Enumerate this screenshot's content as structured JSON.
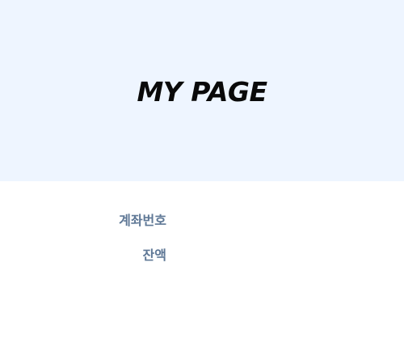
{
  "header": {
    "title": "MY PAGE"
  },
  "account_info": {
    "account_number_label": "계좌번호",
    "balance_label": "잔액"
  },
  "colors": {
    "hero_background": "#eef5ff",
    "label_text": "#5f7896",
    "title_text": "#0a0a0a"
  }
}
